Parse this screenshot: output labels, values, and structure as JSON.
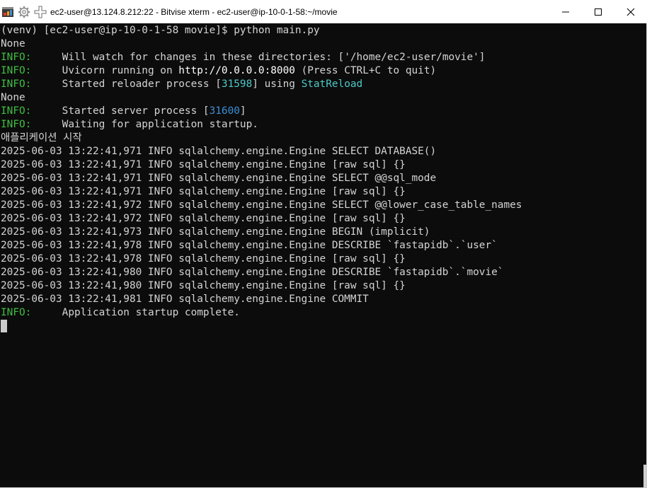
{
  "window": {
    "title": "ec2-user@13.124.8.212:22 - Bitvise xterm - ec2-user@ip-10-0-1-58:~/movie",
    "controls": [
      "minimize",
      "maximize",
      "close"
    ]
  },
  "terminal": {
    "prompt_line": "(venv) [ec2-user@ip-10-0-1-58 movie]$ python main.py",
    "none_1": "None",
    "info_label": "INFO:",
    "info_pad": "     ",
    "watch_line": "Will watch for changes in these directories: ['/home/ec2-user/movie']",
    "uvicorn_pre": "Uvicorn running on ",
    "uvicorn_url": "http://0.0.0.0:8000",
    "uvicorn_post": " (Press CTRL+C to quit)",
    "reloader_pre": "Started reloader process [",
    "reloader_pid": "31598",
    "reloader_mid": "] using ",
    "reloader_name": "StatReload",
    "none_2": "None",
    "server_pre": "Started server process [",
    "server_pid": "31600",
    "server_post": "]",
    "waiting_line": "Waiting for application startup.",
    "korean_line": "애플리케이션 시작",
    "sql_lines": [
      "2025-06-03 13:22:41,971 INFO sqlalchemy.engine.Engine SELECT DATABASE()",
      "2025-06-03 13:22:41,971 INFO sqlalchemy.engine.Engine [raw sql] {}",
      "2025-06-03 13:22:41,971 INFO sqlalchemy.engine.Engine SELECT @@sql_mode",
      "2025-06-03 13:22:41,971 INFO sqlalchemy.engine.Engine [raw sql] {}",
      "2025-06-03 13:22:41,972 INFO sqlalchemy.engine.Engine SELECT @@lower_case_table_names",
      "2025-06-03 13:22:41,972 INFO sqlalchemy.engine.Engine [raw sql] {}",
      "2025-06-03 13:22:41,973 INFO sqlalchemy.engine.Engine BEGIN (implicit)",
      "2025-06-03 13:22:41,978 INFO sqlalchemy.engine.Engine DESCRIBE `fastapidb`.`user`",
      "2025-06-03 13:22:41,978 INFO sqlalchemy.engine.Engine [raw sql] {}",
      "2025-06-03 13:22:41,980 INFO sqlalchemy.engine.Engine DESCRIBE `fastapidb`.`movie`",
      "2025-06-03 13:22:41,980 INFO sqlalchemy.engine.Engine [raw sql] {}",
      "2025-06-03 13:22:41,981 INFO sqlalchemy.engine.Engine COMMIT"
    ],
    "complete_line": "Application startup complete."
  },
  "colors": {
    "terminal_bg": "#0c0c0c",
    "text": "#d4d4d4",
    "info_green": "#3fbf3f",
    "pid_blue": "#3b8fd6",
    "cyan": "#4ec9c9"
  },
  "icons": {
    "app": "bitvise-xterm-icon",
    "settings": "gear-icon",
    "move": "move-arrows-icon"
  }
}
